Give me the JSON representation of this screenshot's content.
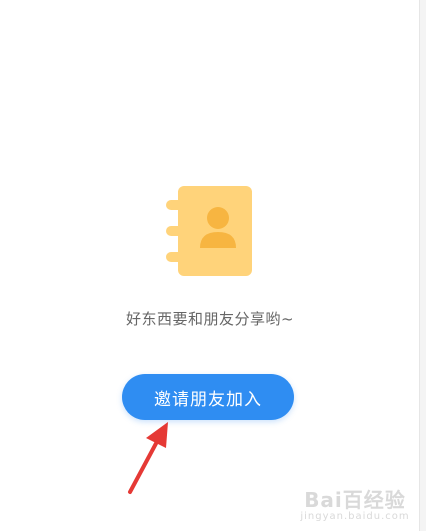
{
  "empty_state": {
    "icon": "contact-book-icon",
    "message": "好东西要和朋友分享哟~"
  },
  "invite_button": {
    "label": "邀请朋友加入"
  },
  "watermark": {
    "logo_text": "Bai百经验",
    "url": "jingyan.baidu.com"
  },
  "colors": {
    "button": "#2f8df2",
    "icon_body": "#ffd37a",
    "icon_figure": "#f7b541",
    "arrow": "#e53935"
  }
}
